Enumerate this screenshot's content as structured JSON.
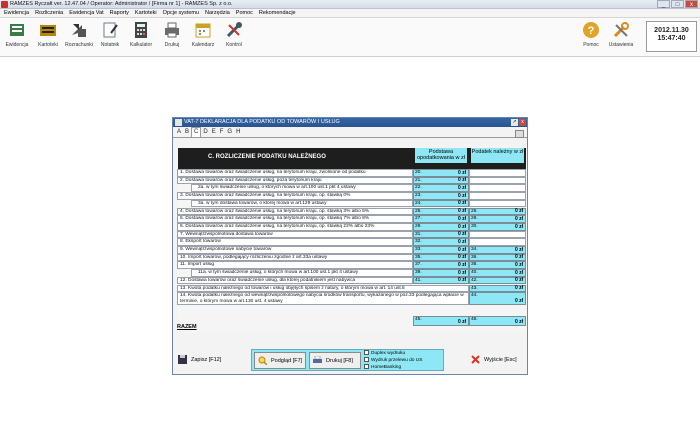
{
  "window": {
    "title": "RAMZES Ryczałt ver. 12.47.04 /   Operator: Administrator /    [Firma nr 1] - RAMZES Sp. z o.o.",
    "controls": [
      "_",
      "□",
      "x"
    ]
  },
  "menu": [
    "Ewidencja",
    "Rozliczenia",
    "Ewidencja Vat",
    "Raporty",
    "Kartoteki",
    "Opcje systemu",
    "Narzędzia",
    "Pomoc",
    "Rekomendacje"
  ],
  "toolbar": [
    {
      "label": "Ewidencja",
      "icon": "ledger-icon",
      "color": "#3a7d44"
    },
    {
      "label": "Kartoteki",
      "icon": "cards-icon",
      "color": "#b8860b"
    },
    {
      "label": "Rozrachunki",
      "icon": "arrows-icon",
      "color": "#555555"
    },
    {
      "label": "Notatnik",
      "icon": "notepad-icon",
      "color": "#6b7a8f"
    },
    {
      "label": "Kalkulator",
      "icon": "calculator-icon",
      "color": "#444444"
    },
    {
      "label": "Drukuj",
      "icon": "printer-icon",
      "color": "#6b6b6b"
    },
    {
      "label": "Kalendarz",
      "icon": "calendar-icon",
      "color": "#c9a227"
    },
    {
      "label": "Kontrol",
      "icon": "tools-icon",
      "color": "#445566"
    }
  ],
  "right_tools": [
    {
      "label": "Pomoc",
      "icon": "help-icon",
      "color": "#e0a526"
    },
    {
      "label": "Ustawienia",
      "icon": "settings-icon",
      "color": "#d98c1e"
    }
  ],
  "clock": {
    "date": "2012.11.30",
    "time": "15:47:40"
  },
  "dialog": {
    "title": "VAT-7 DEKLARACJA DLA PODATKU OD TOWARÓW I USŁUG",
    "tabs": [
      "A",
      "B",
      "C",
      "D",
      "E",
      "F",
      "G",
      "H"
    ],
    "active_tab": "C",
    "section": "C. ROZLICZENIE PODATKU NALEŻNEGO",
    "col1": "Podstawa opodatkowania w zł",
    "col2": "Podatek należny w zł",
    "rows": [
      {
        "label": "1. Dostawa towarów oraz świadczenie usług, na terytorium kraju, zwolnione od podatku",
        "n1": "20.",
        "v1": "0 zł",
        "n2": "",
        "v2": ""
      },
      {
        "label": "2. Dostawa towarów oraz świadczenie usług, poza terytorium kraju",
        "n1": "21.",
        "v1": "0 zł",
        "n2": "",
        "v2": ""
      },
      {
        "label": "2a. w tym świadczenie usług, o których mowa w art.100 ust.1 pkt 4 ustawy",
        "n1": "22.",
        "v1": "0 zł",
        "n2": "",
        "v2": "",
        "indent": true
      },
      {
        "label": "3. Dostawa towarów oraz świadczenie usług, na terytorium kraju, op. stawką 0%",
        "n1": "23.",
        "v1": "0 zł",
        "n2": "",
        "v2": ""
      },
      {
        "label": "3a. w tym dostawa towarów, o której mowa w art.129 ustawy",
        "n1": "24.",
        "v1": "0 zł",
        "n2": "",
        "v2": "",
        "indent": true
      },
      {
        "label": "4. Dostawa towarów oraz świadczenie usług, na terytorium kraju, op. stawką  3% albo 5%",
        "n1": "25.",
        "v1": "0 zł",
        "n2": "26.",
        "v2": "0 zł"
      },
      {
        "label": "5. Dostawa towarów oraz świadczenie usług, na terytorium kraju, op. stawką 7% albo 8%",
        "n1": "27.",
        "v1": "0 zł",
        "n2": "28.",
        "v2": "0 zł"
      },
      {
        "label": "6. Dostawa towarów oraz świadczenie usług, na terytorium kraju, op. stawką 22% albo 23%",
        "n1": "29.",
        "v1": "0 zł",
        "n2": "30.",
        "v2": "0 zł"
      },
      {
        "label": "7. Wewnątrzwspólnotowa dostawa towarów",
        "n1": "31.",
        "v1": "0 zł",
        "n2": "",
        "v2": ""
      },
      {
        "label": "8. Eksport towarów",
        "n1": "32.",
        "v1": "0 zł",
        "n2": "",
        "v2": ""
      },
      {
        "label": "9. Wewnątrzwspólnotowe nabycie towarów",
        "n1": "33.",
        "v1": "0 zł",
        "n2": "34.",
        "v2": "0 zł"
      },
      {
        "label": "10. Import towarów, podlegający rozliczeniu zgodnie z art.33a ustawy",
        "n1": "35.",
        "v1": "0 zł",
        "n2": "36.",
        "v2": "0 zł"
      },
      {
        "label": "11. Import usług",
        "n1": "37.",
        "v1": "0 zł",
        "n2": "38.",
        "v2": "0 zł"
      },
      {
        "label": "11a. w tym świadczenie usług, o których mowa w art.100 ust.1 pkt 4 ustawy",
        "n1": "39.",
        "v1": "0 zł",
        "n2": "40.",
        "v2": "0 zł",
        "indent": true
      },
      {
        "label": "12. Dostawa towarów oraz świadczenie usług, dla której podatnikiem jest nabywca",
        "n1": "41.",
        "v1": "0 zł",
        "n2": "42.",
        "v2": "0 zł"
      },
      {
        "label": "13. Kwota podatku należnego od towarów i usług objętych spisem z natury, o którym mowa w art. 14 ust.5",
        "n1": "",
        "v1": "",
        "n2": "43.",
        "v2": "0 zł"
      },
      {
        "label": "14. Kwota podatku należnego od wewnątrzwspólnotowego nabycia środków transportu, wykazanego w poz.33 podlegająca wpłacie w terminie, o którym mowa w art.130 ust. 4 ustawy",
        "n1": "",
        "v1": "",
        "n2": "44.",
        "v2": "0 zł"
      }
    ],
    "razem": {
      "label": "RAZEM",
      "n1": "45.",
      "v1": "0 zł",
      "n2": "46.",
      "v2": "0 zł"
    },
    "buttons": {
      "save": "Zapisz  [F12]",
      "preview": "Podgląd  [F7]",
      "print": "Drukuj  [F8]",
      "exit": "Wyjście  [Esc]"
    },
    "checkboxes": [
      "Duplex wydruku",
      "Wydruk przelewu do US",
      "HomeBanking"
    ]
  }
}
